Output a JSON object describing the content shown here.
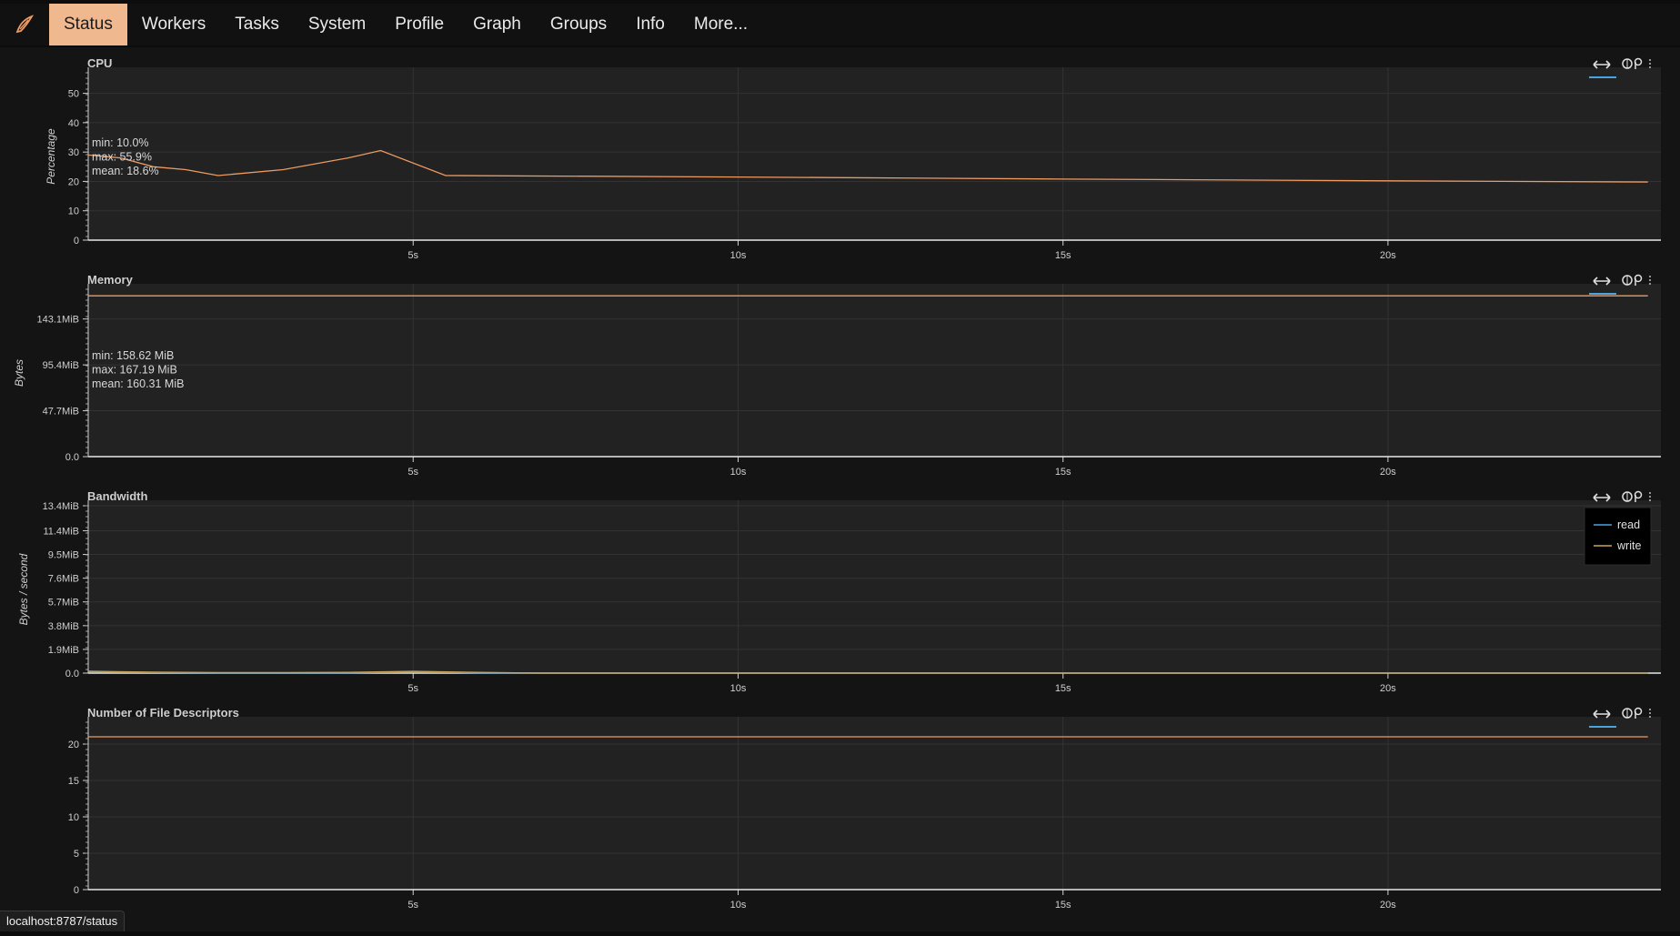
{
  "nav": {
    "tabs": [
      "Status",
      "Workers",
      "Tasks",
      "System",
      "Profile",
      "Graph",
      "Groups",
      "Info",
      "More..."
    ],
    "active": "Status"
  },
  "colors": {
    "accent": "#f0b88e",
    "line": "#ee9b62",
    "read": "#4aa3df",
    "write": "#c9a55a"
  },
  "toolbar_icons": [
    "pan-icon",
    "wheel-zoom-icon",
    "more-tools-icon"
  ],
  "status_url": "localhost:8787/status",
  "charts": [
    {
      "title": "CPU",
      "ylabel": "Percentage",
      "ticks": [
        "50",
        "40",
        "30",
        "20",
        "10",
        "0"
      ],
      "stats": [
        "min: 10.0%",
        "max: 55.9%",
        "mean: 18.6%"
      ]
    },
    {
      "title": "Memory",
      "ylabel": "Bytes",
      "ticks": [
        "143.1MiB",
        "95.4MiB",
        "47.7MiB",
        "0.0"
      ],
      "stats": [
        "min: 158.62 MiB",
        "max: 167.19 MiB",
        "mean: 160.31 MiB"
      ]
    },
    {
      "title": "Bandwidth",
      "ylabel": "Bytes / second",
      "ticks": [
        "13.4MiB",
        "11.4MiB",
        "9.5MiB",
        "7.6MiB",
        "5.7MiB",
        "3.8MiB",
        "1.9MiB",
        "0.0"
      ],
      "legend": [
        "read",
        "write"
      ]
    },
    {
      "title": "Number of File Descriptors",
      "ylabel": "",
      "ticks": [
        "20",
        "15",
        "10",
        "5",
        "0"
      ]
    }
  ],
  "xticks": [
    "5s",
    "10s",
    "15s",
    "20s"
  ],
  "chart_data": [
    {
      "type": "line",
      "title": "CPU",
      "ylabel": "Percentage",
      "ylim": [
        0,
        57
      ],
      "x": [
        0,
        0.5,
        1.0,
        1.5,
        2.0,
        3.0,
        4.0,
        4.5,
        5.5,
        10,
        15,
        20,
        24
      ],
      "series": [
        {
          "values": [
            29,
            28,
            25,
            24,
            22,
            24,
            28,
            30.5,
            22,
            21.5,
            20.8,
            20.2,
            19.8
          ]
        }
      ]
    },
    {
      "type": "line",
      "title": "Memory",
      "ylabel": "Bytes",
      "x": [
        0,
        24
      ],
      "series": [
        {
          "values": [
            167.19,
            167.19
          ]
        }
      ]
    },
    {
      "type": "line",
      "title": "Bandwidth",
      "ylabel": "Bytes / second",
      "x": [
        0,
        1,
        2,
        3,
        4,
        5,
        6,
        7,
        24
      ],
      "series": [
        {
          "name": "read",
          "values": [
            0.1,
            0.05,
            0.02,
            0.02,
            0.02,
            0.08,
            0.02,
            0.0,
            0.0
          ]
        },
        {
          "name": "write",
          "values": [
            0.15,
            0.08,
            0.04,
            0.04,
            0.06,
            0.14,
            0.06,
            0.0,
            0.0
          ]
        }
      ]
    },
    {
      "type": "line",
      "title": "Number of File Descriptors",
      "ylim": [
        0,
        23
      ],
      "x": [
        0,
        24
      ],
      "series": [
        {
          "values": [
            21,
            21
          ]
        }
      ]
    }
  ]
}
